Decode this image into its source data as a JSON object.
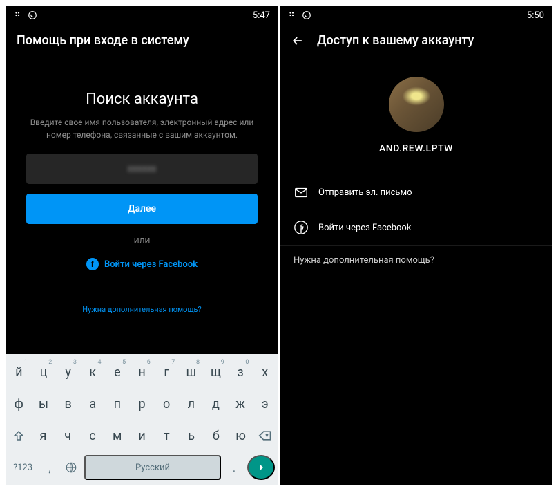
{
  "left": {
    "status_time": "5:47",
    "header_title": "Помощь при входе в систему",
    "search_title": "Поиск аккаунта",
    "search_desc": "Введите свое имя пользователя, электронный адрес или номер телефона, связанные с вашим аккаунтом.",
    "input_value": "xxxxxx",
    "next_label": "Далее",
    "divider_label": "ИЛИ",
    "fb_login": "Войти через Facebook",
    "help_link": "Нужна дополнительная помощь?",
    "keyboard": {
      "row1": [
        {
          "k": "й",
          "n": "1"
        },
        {
          "k": "ц",
          "n": "2"
        },
        {
          "k": "у",
          "n": "3"
        },
        {
          "k": "к",
          "n": "4"
        },
        {
          "k": "е",
          "n": "5"
        },
        {
          "k": "н",
          "n": "6"
        },
        {
          "k": "г",
          "n": "7"
        },
        {
          "k": "ш",
          "n": "8"
        },
        {
          "k": "щ",
          "n": "9"
        },
        {
          "k": "з",
          "n": "0"
        },
        {
          "k": "х",
          "n": ""
        }
      ],
      "row2": [
        {
          "k": "ф"
        },
        {
          "k": "ы"
        },
        {
          "k": "в"
        },
        {
          "k": "а"
        },
        {
          "k": "п"
        },
        {
          "k": "р"
        },
        {
          "k": "о"
        },
        {
          "k": "л"
        },
        {
          "k": "д"
        },
        {
          "k": "ж"
        },
        {
          "k": "э"
        }
      ],
      "row3": [
        {
          "k": "я"
        },
        {
          "k": "ч"
        },
        {
          "k": "с"
        },
        {
          "k": "м"
        },
        {
          "k": "и"
        },
        {
          "k": "т"
        },
        {
          "k": "ь"
        },
        {
          "k": "б"
        },
        {
          "k": "ю"
        }
      ],
      "symbols": "?123",
      "comma": ",",
      "space": "Русский",
      "period": "."
    }
  },
  "right": {
    "status_time": "5:50",
    "header_title": "Доступ к вашему аккаунту",
    "username": "AND.REW.LPTW",
    "option_email": "Отправить эл. письмо",
    "option_fb": "Войти через Facebook",
    "help_text": "Нужна дополнительная помощь?"
  }
}
